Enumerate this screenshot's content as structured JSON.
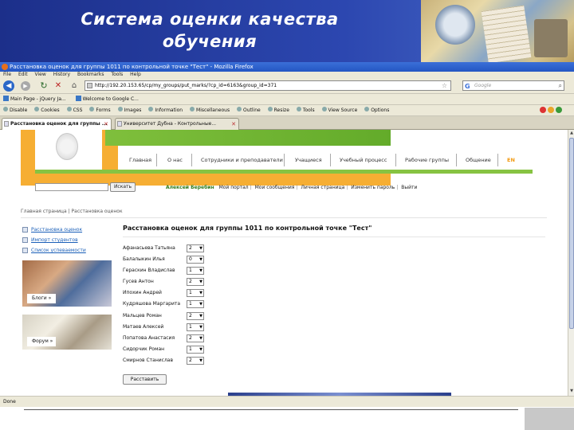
{
  "slide": {
    "title_line1": "Система оценки качества",
    "title_line2": "обучения"
  },
  "window": {
    "title": "Расстановка оценок для группы 1011 по контрольной точке \"Тест\" - Mozilla Firefox"
  },
  "menu": [
    "File",
    "Edit",
    "View",
    "History",
    "Bookmarks",
    "Tools",
    "Help"
  ],
  "nav": {
    "url": "http://192.20.153.65/cp/my_groups/put_marks/?cp_id=6163&group_id=371",
    "search_placeholder": "Google"
  },
  "bookmarks": [
    "Main Page - jQuery Ja...",
    "Welcome to Google C..."
  ],
  "devtools": [
    "Disable",
    "Cookies",
    "CSS",
    "Forms",
    "Images",
    "Information",
    "Miscellaneous",
    "Outline",
    "Resize",
    "Tools",
    "View Source",
    "Options"
  ],
  "tabs": [
    {
      "label": "Расстановка оценок для группы ...",
      "active": true
    },
    {
      "label": "Университет Дубна - Контрольные...",
      "active": false
    }
  ],
  "site": {
    "search_button": "Искать",
    "nav": [
      "Главная",
      "О нас",
      "Сотрудники и преподаватели",
      "Учащиеся",
      "Учебный процесс",
      "Рабочие группы",
      "Общение",
      "EN"
    ],
    "user_name": "Алексей Беребин",
    "user_links": [
      "Мой портал",
      "Мои сообщения",
      "Личная страница",
      "Изменить пароль",
      "Выйти"
    ],
    "breadcrumb": "Главная страница | Расстановка оценок",
    "side_links": [
      "Расстановка оценок",
      "Импорт студентов",
      "Список успеваемости"
    ],
    "photo_buttons": [
      "Блоги",
      "Форум"
    ]
  },
  "content": {
    "title": "Расстановка оценок для группы 1011 по контрольной точке \"Тест\"",
    "students": [
      {
        "name": "Афанасьева Татьяна",
        "grade": "2"
      },
      {
        "name": "Балалыкин Илья",
        "grade": "0"
      },
      {
        "name": "Гераскин Владислав",
        "grade": "1"
      },
      {
        "name": "Гусев Антон",
        "grade": "2"
      },
      {
        "name": "Ипохин Андрей",
        "grade": "1"
      },
      {
        "name": "Кудряшова Маргарита",
        "grade": "1"
      },
      {
        "name": "Мальцев Роман",
        "grade": "2"
      },
      {
        "name": "Матаев Алексей",
        "grade": "1"
      },
      {
        "name": "Попатова Анастасия",
        "grade": "2"
      },
      {
        "name": "Сидорчик Роман",
        "grade": "1"
      },
      {
        "name": "Смирнов Станислав",
        "grade": "2"
      }
    ],
    "save_button": "Расставить"
  },
  "status": {
    "text": "Done"
  }
}
